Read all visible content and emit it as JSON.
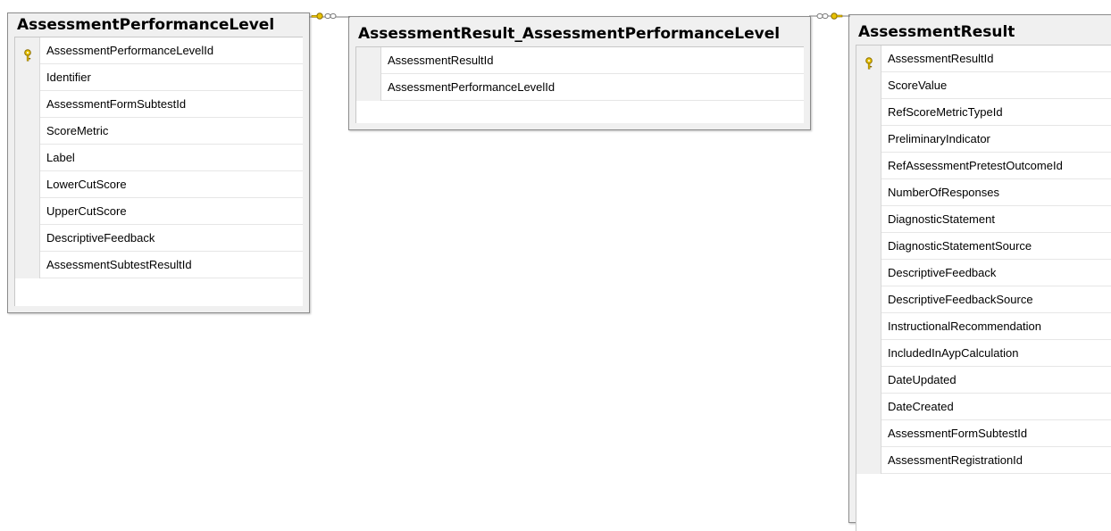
{
  "tables": [
    {
      "title": "AssessmentPerformanceLevel",
      "columns": [
        {
          "name": "AssessmentPerformanceLevelId",
          "primary_key": true
        },
        {
          "name": "Identifier",
          "primary_key": false
        },
        {
          "name": "AssessmentFormSubtestId",
          "primary_key": false
        },
        {
          "name": "ScoreMetric",
          "primary_key": false
        },
        {
          "name": "Label",
          "primary_key": false
        },
        {
          "name": "LowerCutScore",
          "primary_key": false
        },
        {
          "name": "UpperCutScore",
          "primary_key": false
        },
        {
          "name": "DescriptiveFeedback",
          "primary_key": false
        },
        {
          "name": "AssessmentSubtestResultId",
          "primary_key": false
        }
      ]
    },
    {
      "title": "AssessmentResult_AssessmentPerformanceLevel",
      "columns": [
        {
          "name": "AssessmentResultId",
          "primary_key": false
        },
        {
          "name": "AssessmentPerformanceLevelId",
          "primary_key": false
        }
      ]
    },
    {
      "title": "AssessmentResult",
      "columns": [
        {
          "name": "AssessmentResultId",
          "primary_key": true
        },
        {
          "name": "ScoreValue",
          "primary_key": false
        },
        {
          "name": "RefScoreMetricTypeId",
          "primary_key": false
        },
        {
          "name": "PreliminaryIndicator",
          "primary_key": false
        },
        {
          "name": "RefAssessmentPretestOutcomeId",
          "primary_key": false
        },
        {
          "name": "NumberOfResponses",
          "primary_key": false
        },
        {
          "name": "DiagnosticStatement",
          "primary_key": false
        },
        {
          "name": "DiagnosticStatementSource",
          "primary_key": false
        },
        {
          "name": "DescriptiveFeedback",
          "primary_key": false
        },
        {
          "name": "DescriptiveFeedbackSource",
          "primary_key": false
        },
        {
          "name": "InstructionalRecommendation",
          "primary_key": false
        },
        {
          "name": "IncludedInAypCalculation",
          "primary_key": false
        },
        {
          "name": "DateUpdated",
          "primary_key": false
        },
        {
          "name": "DateCreated",
          "primary_key": false
        },
        {
          "name": "AssessmentFormSubtestId",
          "primary_key": false
        },
        {
          "name": "AssessmentRegistrationId",
          "primary_key": false
        }
      ]
    }
  ],
  "relationships": [
    {
      "from": "AssessmentPerformanceLevel",
      "to": "AssessmentResult_AssessmentPerformanceLevel",
      "from_end": "key-icon",
      "to_end": "infinity-icon"
    },
    {
      "from": "AssessmentResult",
      "to": "AssessmentResult_AssessmentPerformanceLevel",
      "from_end": "key-icon",
      "to_end": "infinity-icon"
    }
  ],
  "colors": {
    "key": "#e8c200",
    "key_outline": "#8a6d00",
    "connector": "#7a7a7a"
  }
}
